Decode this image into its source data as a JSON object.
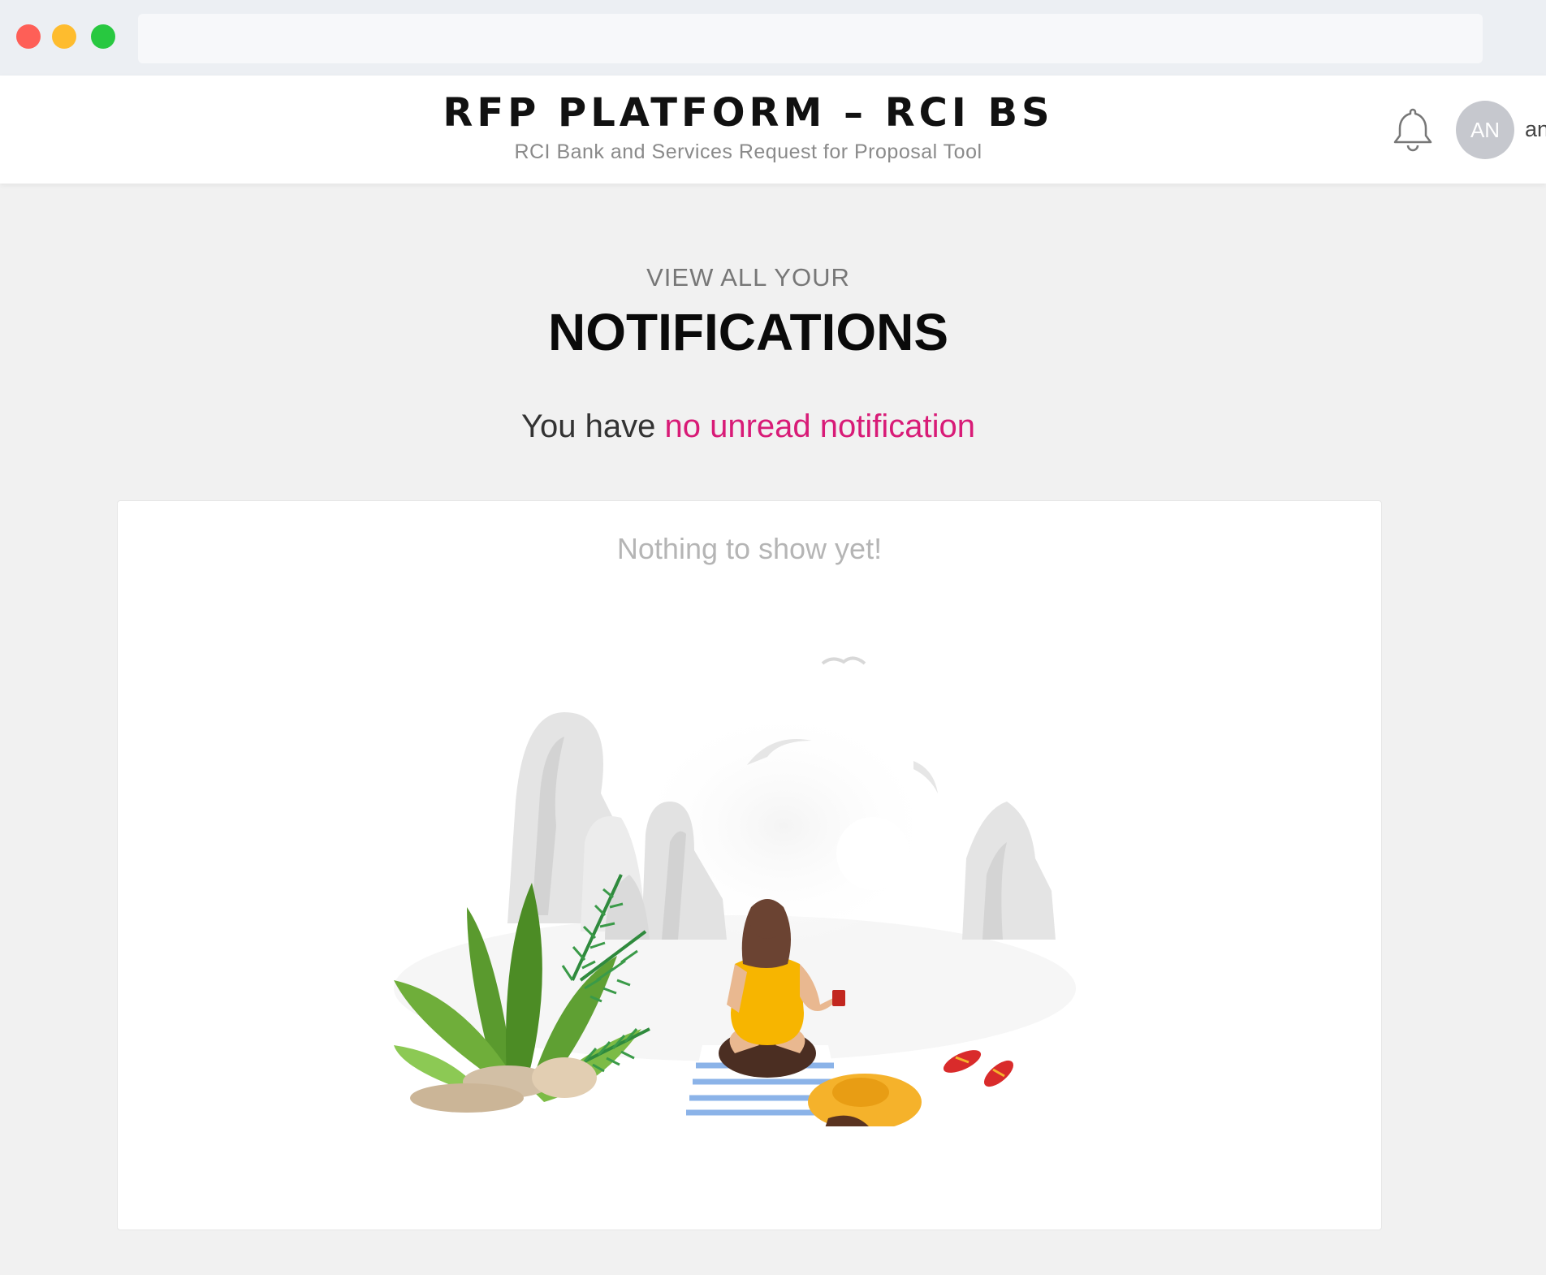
{
  "header": {
    "title": "RFP PLATFORM – RCI BS",
    "subtitle": "RCI Bank and Services Request for Proposal Tool",
    "avatar_initials": "AN",
    "username": "an",
    "bell_icon": "bell-icon"
  },
  "main": {
    "kicker": "VIEW ALL YOUR",
    "title": "NOTIFICATIONS",
    "status_prefix": "You have ",
    "status_highlight": "no unread notification",
    "empty_message": "Nothing to show yet!"
  },
  "colors": {
    "accent": "#d81b77",
    "avatar_bg": "#c6c8ce",
    "background": "#f1f1f1"
  }
}
